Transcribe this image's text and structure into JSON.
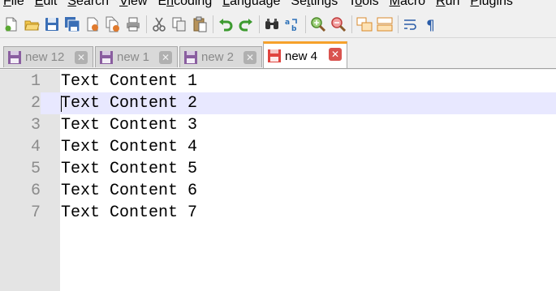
{
  "menu": {
    "items": [
      {
        "label": "File",
        "accel": "F",
        "rest": "ile"
      },
      {
        "label": "Edit",
        "accel": "E",
        "rest": "dit"
      },
      {
        "label": "Search",
        "accel": "S",
        "rest": "earch"
      },
      {
        "label": "View",
        "accel": "V",
        "rest": "iew"
      },
      {
        "label": "Encoding",
        "accel": "n",
        "pre": "E",
        "rest": "coding"
      },
      {
        "label": "Language",
        "accel": "L",
        "rest": "anguage"
      },
      {
        "label": "Settings",
        "accel": "t",
        "pre": "Se",
        "rest": "tings"
      },
      {
        "label": "Tools",
        "accel": "o",
        "pre": "T",
        "rest": "ols"
      },
      {
        "label": "Macro",
        "accel": "M",
        "rest": "acro"
      },
      {
        "label": "Run",
        "accel": "R",
        "rest": "un"
      },
      {
        "label": "Plugins",
        "accel": "P",
        "rest": "lugins"
      }
    ]
  },
  "toolbar": {
    "icons": [
      "new-file",
      "open-file",
      "save",
      "save-all",
      "close",
      "close-all",
      "print",
      "cut",
      "copy",
      "paste",
      "undo",
      "redo",
      "find",
      "replace",
      "zoom-in",
      "zoom-out",
      "sync-vertical",
      "sync-horizontal",
      "word-wrap",
      "show-all-characters"
    ]
  },
  "tabs": [
    {
      "label": "new 12",
      "active": false
    },
    {
      "label": "new 1",
      "active": false
    },
    {
      "label": "new 2",
      "active": false
    },
    {
      "label": "new 4",
      "active": true
    }
  ],
  "editor": {
    "current_line": 2,
    "lines": [
      {
        "num": "1",
        "text": "Text Content 1"
      },
      {
        "num": "2",
        "text": "Text Content 2"
      },
      {
        "num": "3",
        "text": "Text Content 3"
      },
      {
        "num": "4",
        "text": "Text Content 4"
      },
      {
        "num": "5",
        "text": "Text Content 5"
      },
      {
        "num": "6",
        "text": "Text Content 6"
      },
      {
        "num": "7",
        "text": "Text Content 7"
      }
    ]
  },
  "colors": {
    "active_tab_accent": "#f6a12b",
    "current_line_bg": "#e8e8ff",
    "gutter_bg": "#e4e4e4",
    "close_active": "#d9534f"
  }
}
